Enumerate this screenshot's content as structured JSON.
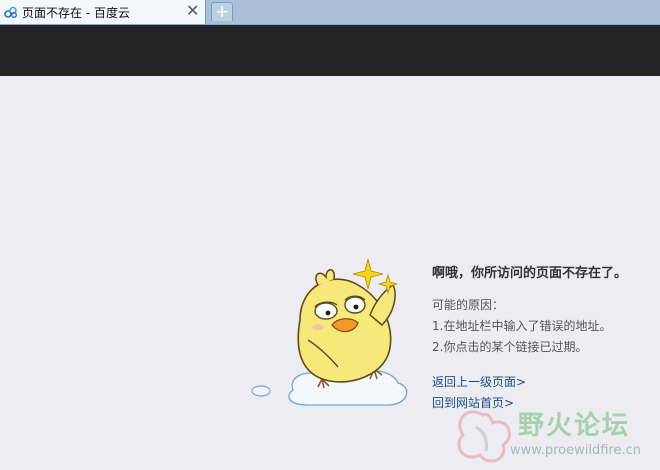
{
  "browser": {
    "tab_title": "页面不存在 - 百度云",
    "close_glyph": "✕",
    "new_tab_glyph": "+"
  },
  "error": {
    "headline": "啊哦，你所访问的页面不存在了。",
    "reasons_title": "可能的原因：",
    "reasons": [
      "1.在地址栏中输入了错误的地址。",
      "2.你点击的某个链接已过期。"
    ],
    "links": [
      "返回上一级页面>",
      "回到网站首页>"
    ]
  },
  "watermark": {
    "text": "野火论坛",
    "url": "www.proewildfire.cn"
  },
  "colors": {
    "tabbar": "#a9c0d8",
    "header": "#232323",
    "page_bg": "#edecf1",
    "link": "#1b4e8a"
  }
}
